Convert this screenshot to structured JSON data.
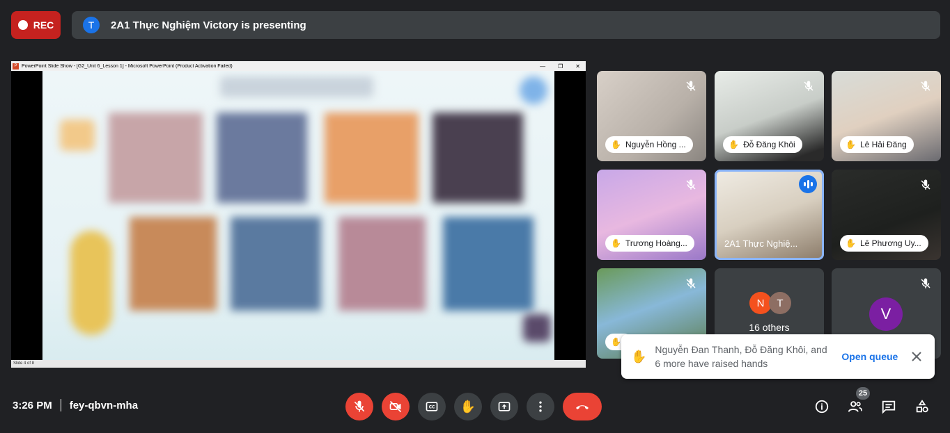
{
  "top": {
    "rec_label": "REC",
    "presenter_initial": "T",
    "presenting_text": "2A1 Thực Nghiệm Victory is presenting"
  },
  "screen_share": {
    "window_title": "PowerPoint Slide Show - [G2_Unit 6_Lesson 1] - Microsoft PowerPoint (Product Activation Failed)",
    "app_icon_letter": "P",
    "slide_status": "Slide 4 of 8"
  },
  "participants": [
    {
      "name": "Nguyễn Hồng ...",
      "muted": true,
      "hand_raised": true
    },
    {
      "name": "Đỗ Đăng Khôi",
      "muted": true,
      "hand_raised": true
    },
    {
      "name": "Lê Hải Đăng",
      "muted": true,
      "hand_raised": true
    },
    {
      "name": "Trương Hoàng...",
      "muted": true,
      "hand_raised": true
    },
    {
      "name": "2A1 Thực Nghiệ...",
      "muted": false,
      "speaking": true
    },
    {
      "name": "Lê Phương Uy...",
      "muted": true,
      "hand_raised": true
    },
    {
      "name": "",
      "muted": true,
      "hand_raised": true
    }
  ],
  "others": {
    "avatars": [
      {
        "letter": "N",
        "color": "#f4511e"
      },
      {
        "letter": "T",
        "color": "#8d6e63"
      }
    ],
    "label": "16 others"
  },
  "muted_tile": {
    "initial": "V",
    "color": "#7b1fa2"
  },
  "toast": {
    "message": "Nguyễn Đan Thanh, Đỗ Đăng Khôi, and 6 more have raised hands",
    "action": "Open queue"
  },
  "bottom": {
    "time": "3:26 PM",
    "meeting_code": "fey-qbvn-mha",
    "people_count": "25"
  },
  "colors": {
    "background": "#202124",
    "danger": "#ea4335",
    "accent": "#1a73e8",
    "control": "#3c4043"
  }
}
